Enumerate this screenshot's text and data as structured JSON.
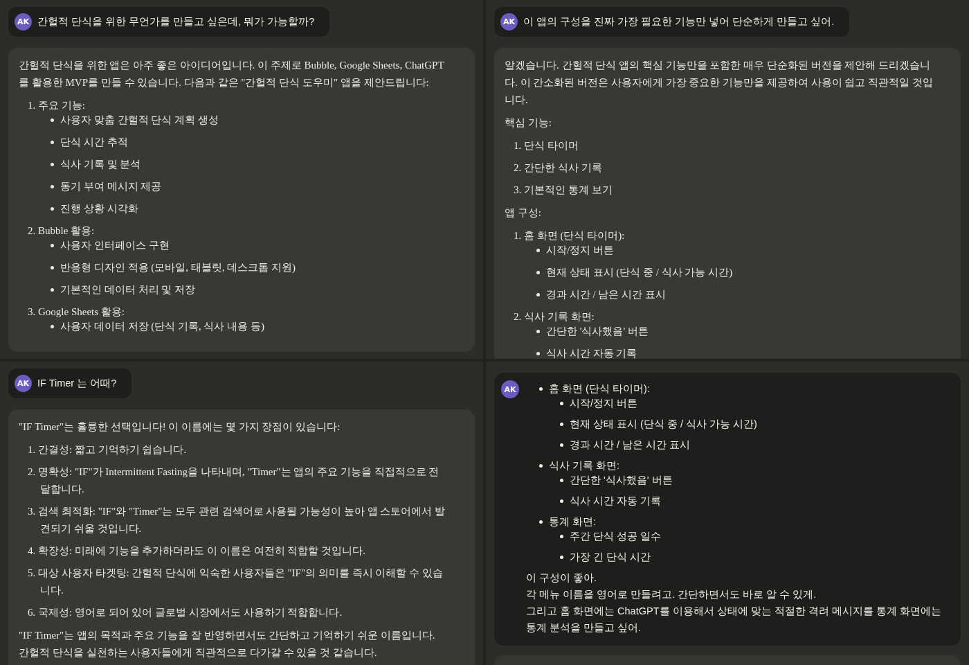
{
  "panels": [
    {
      "messages": [
        {
          "kind": "user_prompt",
          "avatar": "AK",
          "text": "간헐적 단식을 위한 무언가를 만들고 싶은데, 뭐가 가능할까?"
        },
        {
          "kind": "assistant_reply",
          "blocks": [
            {
              "kind": "paragraph",
              "text": "간헐적 단식을 위한 앱은 아주 좋은 아이디어입니다. 이 주제로 Bubble, Google Sheets, ChatGPT를 활용한 MVP를 만들 수 있습니다. 다음과 같은 \"간헐적 단식 도우미\" 앱을 제안드립니다:"
            },
            {
              "kind": "ordered",
              "items": [
                {
                  "marker": "1.",
                  "text": "주요 기능:",
                  "children": [
                    "사용자 맞춤 간헐적 단식 계획 생성",
                    "단식 시간 추적",
                    "식사 기록 및 분석",
                    "동기 부여 메시지 제공",
                    "진행 상황 시각화"
                  ]
                },
                {
                  "marker": "2.",
                  "text": "Bubble 활용:",
                  "children": [
                    "사용자 인터페이스 구현",
                    "반응형 디자인 적용 (모바일, 태블릿, 데스크톱 지원)",
                    "기본적인 데이터 처리 및 저장"
                  ]
                },
                {
                  "marker": "3.",
                  "text": "Google Sheets 활용:",
                  "children": [
                    "사용자 데이터 저장 (단식 기록, 식사 내용 등)"
                  ]
                }
              ]
            }
          ]
        }
      ]
    },
    {
      "messages": [
        {
          "kind": "user_prompt",
          "avatar": "AK",
          "text": "이 앱의 구성을 진짜 가장 필요한 기능만 넣어 단순하게 만들고 싶어."
        },
        {
          "kind": "assistant_reply",
          "blocks": [
            {
              "kind": "paragraph",
              "text": "알겠습니다. 간헐적 단식 앱의 핵심 기능만을 포함한 매우 단순화된 버전을 제안해 드리겠습니다. 이 간소화된 버전은 사용자에게 가장 중요한 기능만을 제공하여 사용이 쉽고 직관적일 것입니다."
            },
            {
              "kind": "paragraph",
              "text": "핵심 기능:"
            },
            {
              "kind": "ordered",
              "items": [
                {
                  "marker": "1.",
                  "text": "단식 타이머"
                },
                {
                  "marker": "2.",
                  "text": "간단한 식사 기록"
                },
                {
                  "marker": "3.",
                  "text": "기본적인 통계 보기"
                }
              ]
            },
            {
              "kind": "paragraph",
              "text": "앱 구성:"
            },
            {
              "kind": "ordered",
              "items": [
                {
                  "marker": "1.",
                  "text": "홈 화면 (단식 타이머):",
                  "children": [
                    "시작/정지 버튼",
                    "현재 상태 표시 (단식 중 / 식사 가능 시간)",
                    "경과 시간 / 남은 시간 표시"
                  ]
                },
                {
                  "marker": "2.",
                  "text": "식사 기록 화면:",
                  "children": [
                    "간단한 '식사했음' 버튼",
                    "식사 시간 자동 기록"
                  ]
                }
              ]
            }
          ]
        }
      ]
    },
    {
      "messages": [
        {
          "kind": "user_prompt",
          "avatar": "AK",
          "text": "IF Timer 는 어때?"
        },
        {
          "kind": "assistant_reply",
          "blocks": [
            {
              "kind": "paragraph",
              "text": "\"IF Timer\"는 훌륭한 선택입니다! 이 이름에는 몇 가지 장점이 있습니다:"
            },
            {
              "kind": "ordered",
              "items": [
                {
                  "marker": "1.",
                  "text": "간결성: 짧고 기억하기 쉽습니다."
                },
                {
                  "marker": "2.",
                  "text": "명확성: \"IF\"가 Intermittent Fasting을 나타내며, \"Timer\"는 앱의 주요 기능을 직접적으로 전달합니다."
                },
                {
                  "marker": "3.",
                  "text": "검색 최적화: \"IF\"와 \"Timer\"는 모두 관련 검색어로 사용될 가능성이 높아 앱 스토어에서 발견되기 쉬울 것입니다."
                },
                {
                  "marker": "4.",
                  "text": "확장성: 미래에 기능을 추가하더라도 이 이름은 여전히 적합할 것입니다."
                },
                {
                  "marker": "5.",
                  "text": "대상 사용자 타겟팅: 간헐적 단식에 익숙한 사용자들은 \"IF\"의 의미를 즉시 이해할 수 있습니다."
                },
                {
                  "marker": "6.",
                  "text": "국제성: 영어로 되어 있어 글로벌 시장에서도 사용하기 적합합니다."
                }
              ]
            },
            {
              "kind": "paragraph",
              "text": "\"IF Timer\"는 앱의 목적과 주요 기능을 잘 반영하면서도 간단하고 기억하기 쉬운 이름입니다. 간헐적 단식을 실천하는 사용자들에게 직관적으로 다가갈 수 있을 것 같습니다."
            }
          ]
        }
      ]
    },
    {
      "messages": [
        {
          "kind": "user_card",
          "avatar": "AK",
          "blocks": [
            {
              "kind": "bullets",
              "items": [
                {
                  "text": "홈 화면 (단식 타이머):",
                  "children": [
                    "시작/정지 버튼",
                    "현재 상태 표시 (단식 중 / 식사 가능 시간)",
                    "경과 시간 / 남은 시간 표시"
                  ]
                },
                {
                  "text": "식사 기록 화면:",
                  "children": [
                    "간단한 '식사했음' 버튼",
                    "식사 시간 자동 기록"
                  ]
                },
                {
                  "text": "통계 화면:",
                  "children": [
                    "주간 단식 성공 일수",
                    "가장 긴 단식 시간"
                  ]
                }
              ]
            },
            {
              "kind": "lines",
              "lines": [
                "이 구성이 좋아.",
                "각 메뉴 이름을 영어로 만들려고. 간단하면서도 바로 알 수 있게.",
                "그리고 홈 화면에는 ChatGPT를 이용해서 상태에 맞는 적절한 격려 메시지를 통계 화면에는 통계 분석을 만들고 싶어."
              ]
            }
          ]
        }
      ]
    }
  ]
}
